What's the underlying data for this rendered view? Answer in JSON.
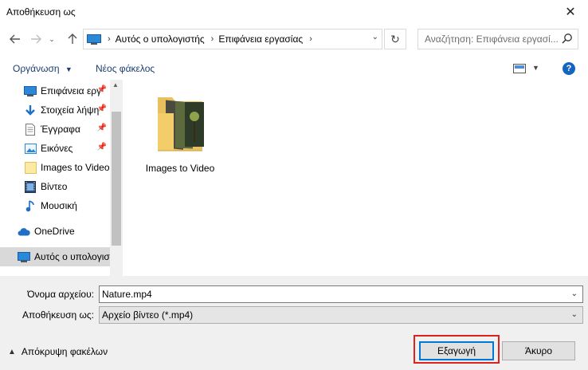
{
  "window": {
    "title": "Αποθήκευση ως"
  },
  "address": {
    "crumbs": [
      "Αυτός ο υπολογιστής",
      "Επιφάνεια εργασίας"
    ]
  },
  "search": {
    "placeholder": "Αναζήτηση: Επιφάνεια εργασί..."
  },
  "toolbar": {
    "organize_label": "Οργάνωση",
    "new_folder_label": "Νέος φάκελος",
    "help_label": "?"
  },
  "sidebar": {
    "items": [
      {
        "label": "Επιφάνεια εργ",
        "icon": "desktop-icon",
        "pinned": true
      },
      {
        "label": "Στοιχεία λήψη",
        "icon": "download-icon",
        "pinned": true
      },
      {
        "label": "Έγγραφα",
        "icon": "document-icon",
        "pinned": true
      },
      {
        "label": "Εικόνες",
        "icon": "pictures-icon",
        "pinned": true
      },
      {
        "label": "Images to Video",
        "icon": "folder-icon",
        "pinned": false
      },
      {
        "label": "Βίντεο",
        "icon": "video-icon",
        "pinned": false
      },
      {
        "label": "Μουσική",
        "icon": "music-icon",
        "pinned": false
      },
      {
        "label": "OneDrive",
        "icon": "cloud-icon",
        "pinned": false
      },
      {
        "label": "Αυτός ο υπολογισ",
        "icon": "computer-icon",
        "pinned": false,
        "selected": true
      }
    ]
  },
  "content": {
    "items": [
      {
        "label": "Images to Video",
        "icon": "folder-with-images-icon"
      }
    ]
  },
  "form": {
    "filename_label": "Όνομα αρχείου:",
    "filename_value": "Nature.mp4",
    "filetype_label": "Αποθήκευση ως:",
    "filetype_value": "Αρχείο βίντεο (*.mp4)"
  },
  "footer": {
    "hide_folders_label": "Απόκρυψη φακέλων",
    "save_label": "Εξαγωγή",
    "cancel_label": "Άκυρο"
  },
  "colors": {
    "accent": "#0078d7",
    "highlight_box": "#e0201b",
    "link_text": "#1a3e6e"
  }
}
